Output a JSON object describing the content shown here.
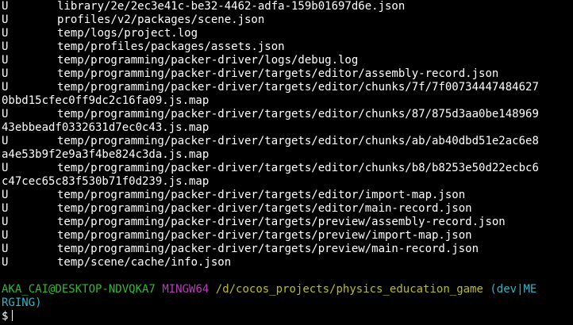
{
  "colors": {
    "background": "#000000",
    "text": "#ffffff",
    "user_host": "#31b735",
    "msystem": "#bf39bf",
    "path": "#bcbc1b",
    "branch": "#30b6c4"
  },
  "status_lines": [
    {
      "status": "U",
      "path": "library/2e/2ec3e41c-be32-4462-adfa-159b01697d6e.json"
    },
    {
      "status": "U",
      "path": "profiles/v2/packages/scene.json"
    },
    {
      "status": "U",
      "path": "temp/logs/project.log"
    },
    {
      "status": "U",
      "path": "temp/profiles/packages/assets.json"
    },
    {
      "status": "U",
      "path": "temp/programming/packer-driver/logs/debug.log"
    },
    {
      "status": "U",
      "path": "temp/programming/packer-driver/targets/editor/assembly-record.json"
    },
    {
      "status": "U",
      "path": "temp/programming/packer-driver/targets/editor/chunks/7f/7f00734447484627",
      "wrap": "0bbd15cfec0ff9dc2c16fa09.js.map"
    },
    {
      "status": "U",
      "path": "temp/programming/packer-driver/targets/editor/chunks/87/875d3aa0be148969",
      "wrap": "43ebbeadf0332631d7ec0c43.js.map"
    },
    {
      "status": "U",
      "path": "temp/programming/packer-driver/targets/editor/chunks/ab/ab40dbd51e2ac6e8",
      "wrap": "a4e53b9f2e9a3f4be824c3da.js.map"
    },
    {
      "status": "U",
      "path": "temp/programming/packer-driver/targets/editor/chunks/b8/b8253e50d22ecbc6",
      "wrap": "c47cec65c83f530b71f0d239.js.map"
    },
    {
      "status": "U",
      "path": "temp/programming/packer-driver/targets/editor/import-map.json"
    },
    {
      "status": "U",
      "path": "temp/programming/packer-driver/targets/editor/main-record.json"
    },
    {
      "status": "U",
      "path": "temp/programming/packer-driver/targets/preview/assembly-record.json"
    },
    {
      "status": "U",
      "path": "temp/programming/packer-driver/targets/preview/import-map.json"
    },
    {
      "status": "U",
      "path": "temp/programming/packer-driver/targets/preview/main-record.json"
    },
    {
      "status": "U",
      "path": "temp/scene/cache/info.json"
    }
  ],
  "prompt": {
    "user_host": "AKA_CAI@DESKTOP-NDVQKA7",
    "msystem": "MINGW64",
    "cwd": "/d/cocos_projects/physics_education_game",
    "branch_line1": "(dev|ME",
    "branch_line2": "RGING)",
    "symbol": "$"
  }
}
